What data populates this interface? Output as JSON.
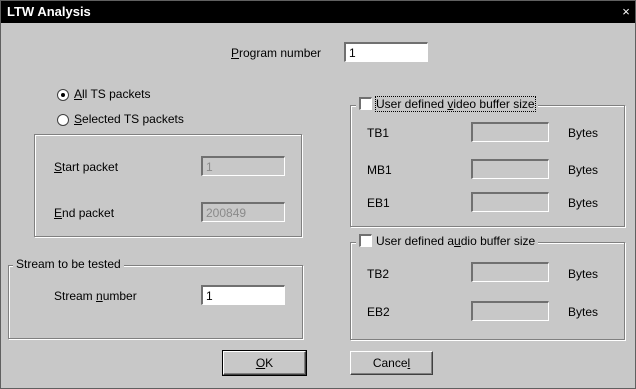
{
  "window": {
    "title": "LTW Analysis",
    "close_glyph": "×"
  },
  "program": {
    "label_u": "P",
    "label_rest": "rogram number",
    "value": "1"
  },
  "packets": {
    "all": {
      "label_u": "A",
      "label_rest": "ll TS packets",
      "selected": true
    },
    "sel": {
      "label_u": "S",
      "label_rest": "elected TS packets",
      "selected": false
    }
  },
  "range": {
    "start_u": "S",
    "start_rest": "tart packet",
    "start_value": "1",
    "end_u": "E",
    "end_rest": "nd packet",
    "end_value": "200849"
  },
  "stream": {
    "group_title": "Stream to be tested",
    "label_pre": "Stream ",
    "label_u": "n",
    "label_rest": "umber",
    "value": "1"
  },
  "video": {
    "title_pre": "User defined ",
    "title_u": "v",
    "title_rest": "ideo buffer size",
    "rows": [
      {
        "name": "TB1",
        "unit": "Bytes"
      },
      {
        "name": "MB1",
        "unit": "Bytes"
      },
      {
        "name": "EB1",
        "unit": "Bytes"
      }
    ]
  },
  "audio": {
    "title_pre": "User defined a",
    "title_u": "u",
    "title_rest": "dio buffer size",
    "rows": [
      {
        "name": "TB2",
        "unit": "Bytes"
      },
      {
        "name": "EB2",
        "unit": "Bytes"
      }
    ]
  },
  "buttons": {
    "ok_u": "O",
    "ok_rest": "K",
    "cancel_pre": "Cance",
    "cancel_u": "l"
  }
}
